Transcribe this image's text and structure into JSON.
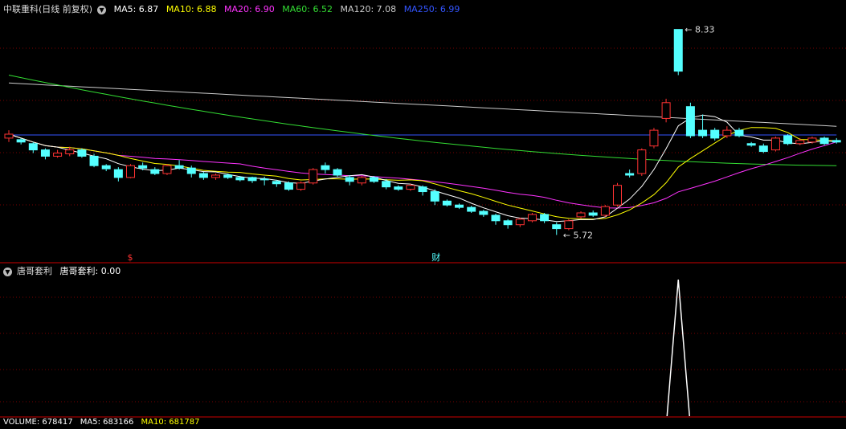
{
  "header": {
    "stock_title": "中联重科(日线 前复权)",
    "ma": [
      {
        "label": "MA5: 6.87",
        "color": "#ffffff"
      },
      {
        "label": "MA10: 6.88",
        "color": "#ffff00"
      },
      {
        "label": "MA20: 6.90",
        "color": "#ff33ff"
      },
      {
        "label": "MA60: 6.52",
        "color": "#33dd33"
      },
      {
        "label": "MA120: 7.08",
        "color": "#cccccc"
      },
      {
        "label": "MA250: 6.99",
        "color": "#3355ff"
      }
    ]
  },
  "indicator": {
    "name": "唐哥套利",
    "value_label": "唐哥套利: 0.00"
  },
  "volume_header": {
    "label": "VOLUME: 678417",
    "ma5_label": "MA5: 683166",
    "ma10_label": "MA10: 681787"
  },
  "colors": {
    "up": "#ff3333",
    "down": "#54ffff",
    "grid": "#7a0000",
    "divider": "#cc0000"
  },
  "chart_data": {
    "type": "candlestick",
    "price_range": [
      5.5,
      8.5
    ],
    "high_label": "8.33",
    "low_label": "5.72",
    "markers": [
      {
        "index": 10,
        "text": "$",
        "color": "#ff3333"
      },
      {
        "index": 35,
        "text": "财",
        "color": "#54ffff"
      }
    ],
    "candles": [
      [
        6.95,
        7.0,
        6.9,
        7.05
      ],
      [
        6.93,
        6.9,
        6.87,
        6.95
      ],
      [
        6.88,
        6.8,
        6.76,
        6.9
      ],
      [
        6.8,
        6.72,
        6.68,
        6.82
      ],
      [
        6.72,
        6.76,
        6.7,
        6.8
      ],
      [
        6.75,
        6.8,
        6.72,
        6.84
      ],
      [
        6.8,
        6.72,
        6.7,
        6.82
      ],
      [
        6.72,
        6.6,
        6.58,
        6.75
      ],
      [
        6.6,
        6.56,
        6.53,
        6.62
      ],
      [
        6.55,
        6.45,
        6.4,
        6.58
      ],
      [
        6.45,
        6.6,
        6.44,
        6.62
      ],
      [
        6.6,
        6.57,
        6.54,
        6.64
      ],
      [
        6.55,
        6.5,
        6.48,
        6.58
      ],
      [
        6.5,
        6.6,
        6.48,
        6.62
      ],
      [
        6.6,
        6.57,
        6.55,
        6.67
      ],
      [
        6.57,
        6.5,
        6.45,
        6.6
      ],
      [
        6.5,
        6.45,
        6.42,
        6.52
      ],
      [
        6.45,
        6.48,
        6.42,
        6.5
      ],
      [
        6.48,
        6.45,
        6.43,
        6.5
      ],
      [
        6.45,
        6.42,
        6.4,
        6.47
      ],
      [
        6.45,
        6.41,
        6.38,
        6.46
      ],
      [
        6.43,
        6.42,
        6.35,
        6.46
      ],
      [
        6.4,
        6.37,
        6.33,
        6.42
      ],
      [
        6.38,
        6.3,
        6.28,
        6.4
      ],
      [
        6.3,
        6.38,
        6.28,
        6.4
      ],
      [
        6.38,
        6.55,
        6.36,
        6.57
      ],
      [
        6.6,
        6.55,
        6.5,
        6.64
      ],
      [
        6.55,
        6.48,
        6.46,
        6.57
      ],
      [
        6.45,
        6.4,
        6.35,
        6.48
      ],
      [
        6.38,
        6.45,
        6.35,
        6.47
      ],
      [
        6.45,
        6.4,
        6.38,
        6.47
      ],
      [
        6.4,
        6.33,
        6.3,
        6.43
      ],
      [
        6.33,
        6.3,
        6.28,
        6.35
      ],
      [
        6.3,
        6.35,
        6.28,
        6.37
      ],
      [
        6.33,
        6.27,
        6.22,
        6.35
      ],
      [
        6.27,
        6.15,
        6.1,
        6.3
      ],
      [
        6.15,
        6.1,
        6.08,
        6.17
      ],
      [
        6.1,
        6.07,
        6.05,
        6.12
      ],
      [
        6.07,
        6.02,
        6.0,
        6.09
      ],
      [
        6.02,
        5.98,
        5.95,
        6.04
      ],
      [
        5.97,
        5.9,
        5.85,
        5.99
      ],
      [
        5.9,
        5.85,
        5.8,
        5.92
      ],
      [
        5.85,
        5.92,
        5.82,
        5.94
      ],
      [
        5.9,
        5.98,
        5.88,
        6.0
      ],
      [
        5.98,
        5.9,
        5.87,
        6.0
      ],
      [
        5.85,
        5.8,
        5.72,
        5.88
      ],
      [
        5.8,
        5.9,
        5.78,
        5.92
      ],
      [
        5.95,
        6.0,
        5.93,
        6.02
      ],
      [
        6.0,
        5.97,
        5.95,
        6.03
      ],
      [
        5.97,
        6.08,
        5.95,
        6.1
      ],
      [
        6.1,
        6.35,
        6.08,
        6.38
      ],
      [
        6.5,
        6.48,
        6.45,
        6.55
      ],
      [
        6.5,
        6.8,
        6.47,
        6.82
      ],
      [
        6.85,
        7.05,
        6.82,
        7.08
      ],
      [
        7.2,
        7.4,
        7.15,
        7.45
      ],
      [
        8.33,
        7.8,
        7.75,
        8.33
      ],
      [
        7.35,
        6.98,
        6.95,
        7.4
      ],
      [
        7.05,
        6.98,
        6.95,
        7.25
      ],
      [
        7.05,
        6.95,
        6.92,
        7.08
      ],
      [
        6.98,
        7.05,
        6.95,
        7.1
      ],
      [
        7.05,
        6.98,
        6.96,
        7.08
      ],
      [
        6.88,
        6.86,
        6.84,
        6.9
      ],
      [
        6.85,
        6.78,
        6.76,
        6.88
      ],
      [
        6.8,
        6.95,
        6.78,
        6.97
      ],
      [
        6.98,
        6.88,
        6.86,
        7.0
      ],
      [
        6.88,
        6.92,
        6.86,
        6.95
      ],
      [
        6.9,
        6.95,
        6.88,
        6.97
      ],
      [
        6.95,
        6.88,
        6.86,
        6.97
      ],
      [
        6.92,
        6.9,
        6.88,
        6.95
      ]
    ],
    "indicator_spike_index": 55
  }
}
